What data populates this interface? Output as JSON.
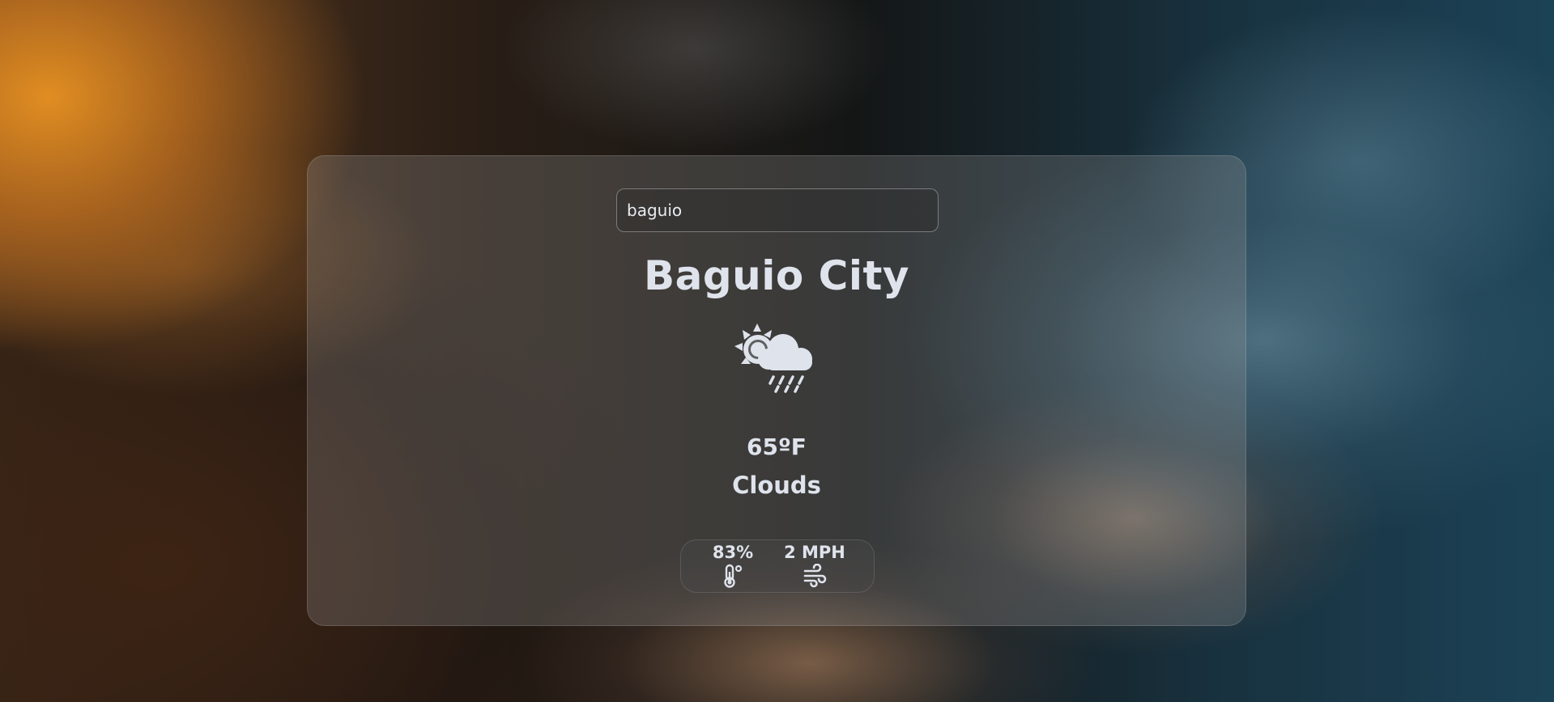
{
  "search": {
    "value": "baguio"
  },
  "location": {
    "city": "Baguio City"
  },
  "current": {
    "temperature": "65ºF",
    "condition": "Clouds",
    "icon": "sun-cloud-rain-icon"
  },
  "details": {
    "humidity": "83%",
    "humidity_icon": "thermometer-icon",
    "wind": "2 MPH",
    "wind_icon": "wind-icon"
  },
  "colors": {
    "text": "#dfe3ec",
    "panel": "rgba(150,150,150,0.28)"
  }
}
